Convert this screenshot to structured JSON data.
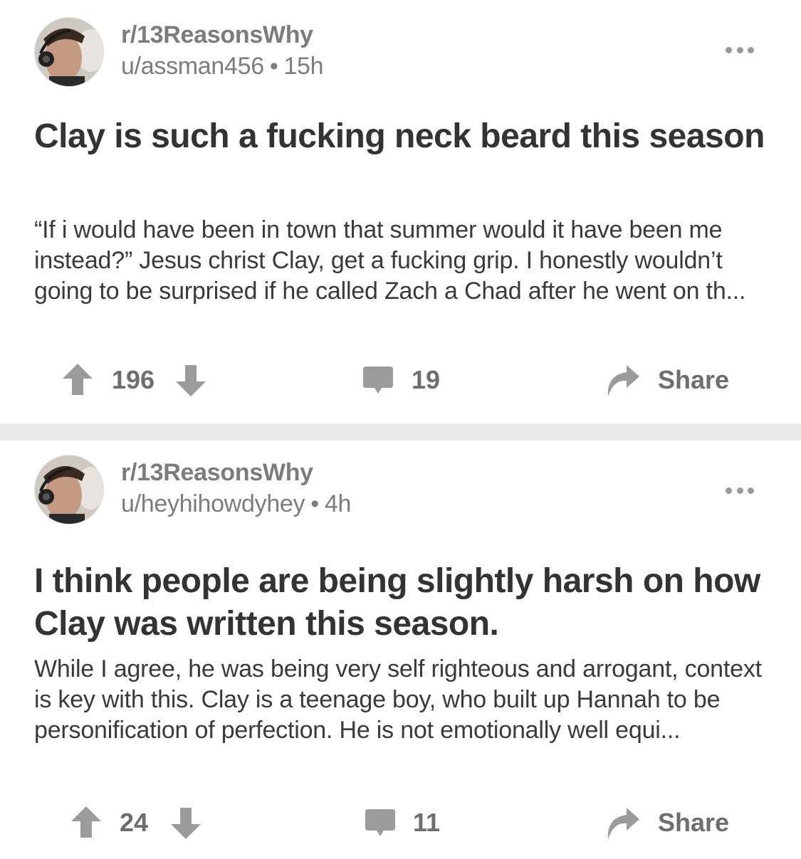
{
  "posts": [
    {
      "subreddit": "r/13ReasonsWhy",
      "author": "u/assman456",
      "separator": "•",
      "age": "15h",
      "title": "Clay is such a fucking neck beard this season",
      "body": "“If i would have been in town that summer would it have been me instead?”  Jesus christ Clay, get a fucking grip. I honestly wouldn’t going to be surprised if he called Zach a Chad after he went on th...",
      "score": "196",
      "comments": "19",
      "share_label": "Share"
    },
    {
      "subreddit": "r/13ReasonsWhy",
      "author": "u/heyhihowdyhey",
      "separator": "•",
      "age": "4h",
      "title": "I think people are being slightly harsh on how Clay was written this season.",
      "body": "While I agree, he was being very self righteous and arrogant, context is key with this.  Clay is a teenage boy, who built up Hannah to be personification of perfection. He is not emotionally well equi...",
      "score": "24",
      "comments": "11",
      "share_label": "Share"
    }
  ],
  "icons": {
    "upvote": "arrow-up-icon",
    "downvote": "arrow-down-icon",
    "comment": "comment-bubble-icon",
    "share": "share-arrow-icon",
    "more": "more-dots-icon"
  },
  "colors": {
    "meta_text": "#7c7c7c",
    "action_icon": "#9b9b9b",
    "divider": "#e9eaec",
    "title_text": "#333333"
  }
}
